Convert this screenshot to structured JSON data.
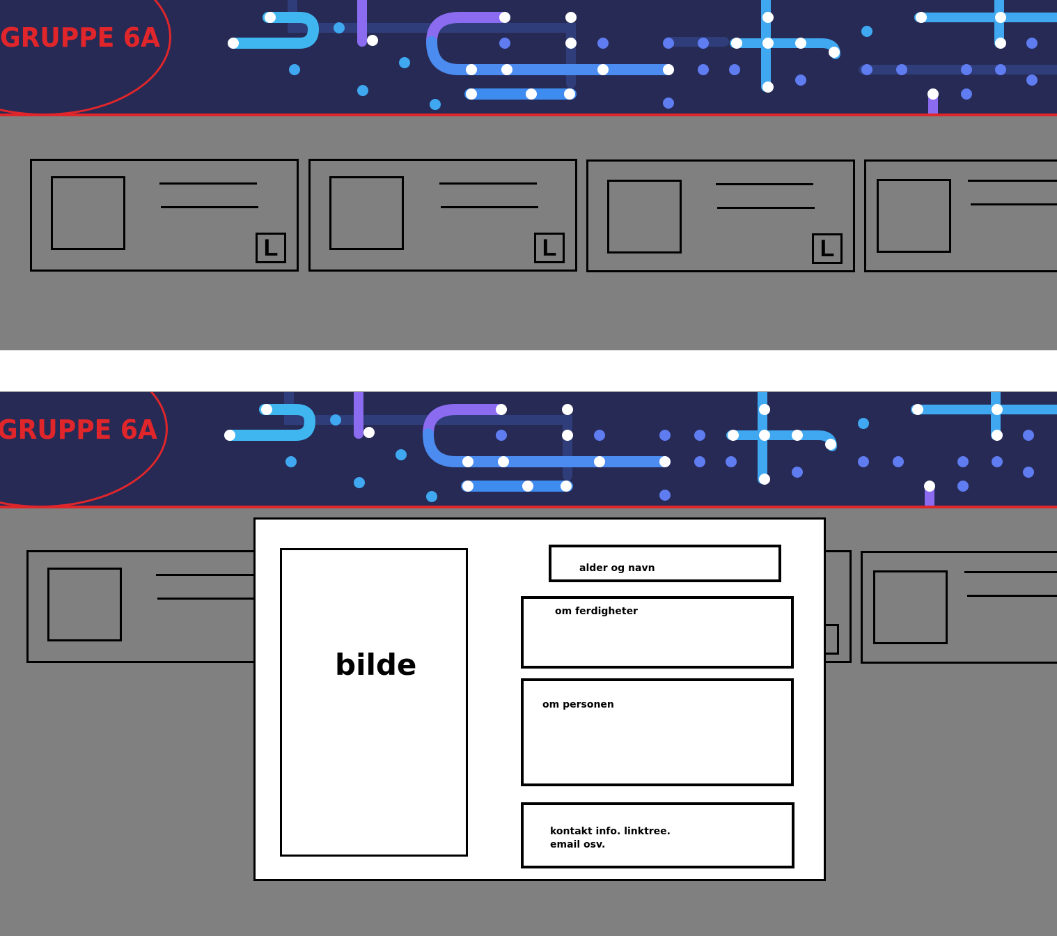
{
  "brand": {
    "title": "GRUPPE 6A",
    "accent_color": "#e0262b",
    "banner_color": "#262a55"
  },
  "cards": [
    {
      "badge": "L"
    },
    {
      "badge": "L"
    },
    {
      "badge": "L"
    },
    {
      "badge": ""
    }
  ],
  "modal": {
    "photo_label": "bilde",
    "name_label": "alder og navn",
    "skills_label": "om ferdigheter",
    "about_label": "om personen",
    "contact_line1": "kontakt info. linktree.",
    "contact_line2": "email osv."
  }
}
